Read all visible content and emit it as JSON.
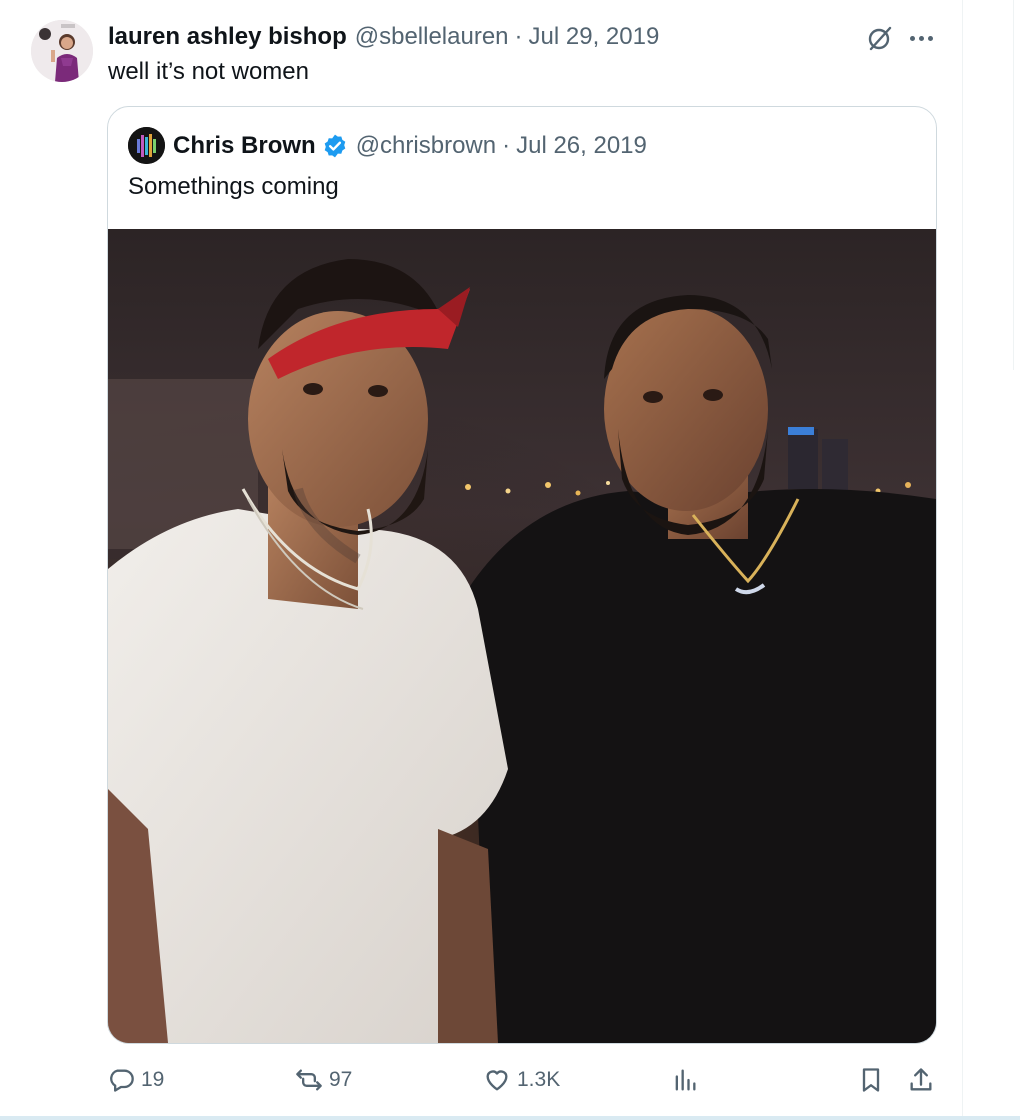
{
  "tweet": {
    "author_name": "lauren ashley bishop",
    "author_handle": "@sbellelauren",
    "separator": "·",
    "date": "Jul 29, 2019",
    "text": "well it’s not women",
    "icons": {
      "grok": "grok-icon",
      "more": "more-icon"
    }
  },
  "quote": {
    "author_name": "Chris Brown",
    "verified": true,
    "author_handle": "@chrisbrown",
    "separator": "·",
    "date": "Jul 26, 2019",
    "text": "Somethings coming",
    "media": "photo-of-two-men-at-night-rooftop"
  },
  "actions": {
    "replies": "19",
    "reposts": "97",
    "likes": "1.3K",
    "icons": [
      "reply-icon",
      "repost-icon",
      "like-icon",
      "views-icon",
      "bookmark-icon",
      "share-icon"
    ]
  },
  "colors": {
    "text": "#0f1419",
    "secondary": "#536471",
    "border": "#cfd9de",
    "verified": "#1d9bf0"
  }
}
